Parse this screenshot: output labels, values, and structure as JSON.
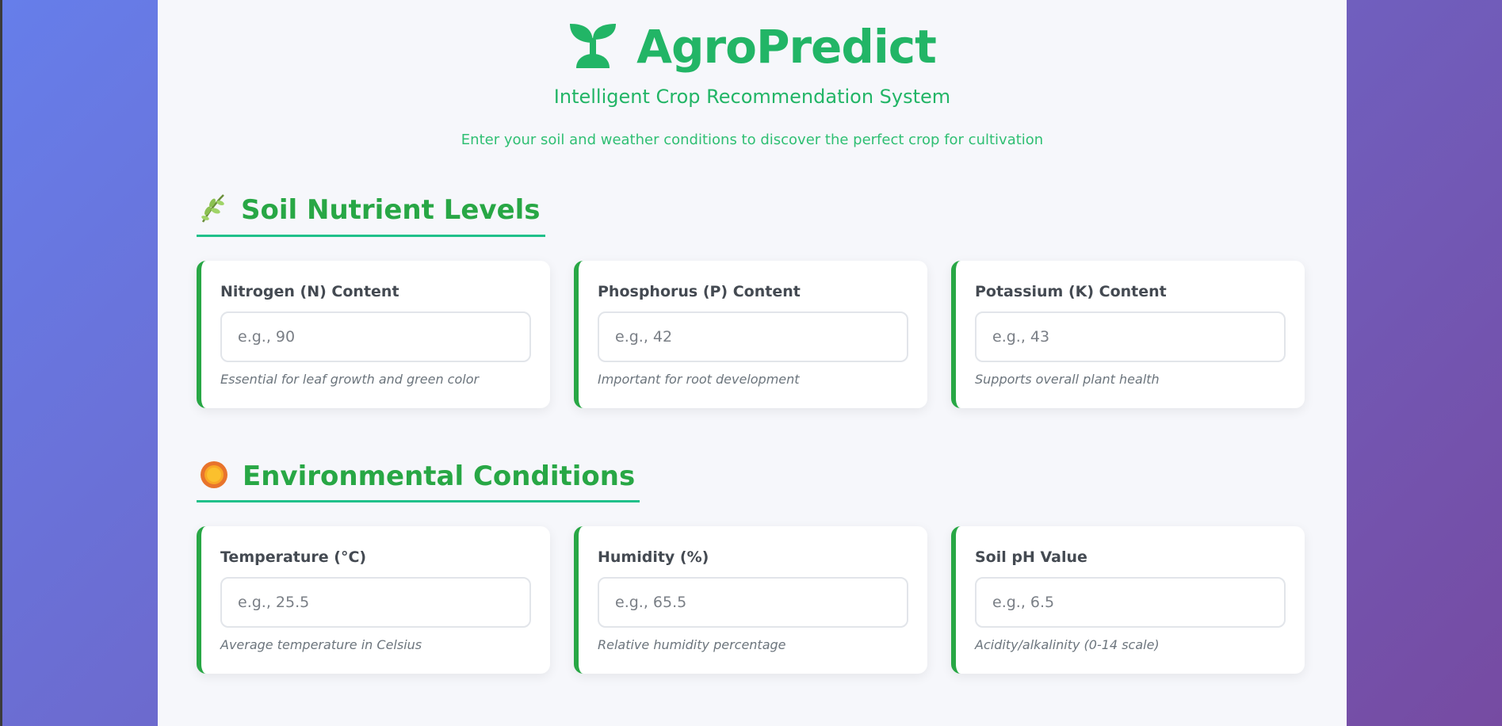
{
  "app": {
    "title": "AgroPredict",
    "subtitle": "Intelligent Crop Recommendation System",
    "tagline": "Enter your soil and weather conditions to discover the perfect crop for cultivation"
  },
  "sections": [
    {
      "icon": "herb-icon",
      "title": "Soil Nutrient Levels",
      "fields": [
        {
          "label": "Nitrogen (N) Content",
          "placeholder": "e.g., 90",
          "help": "Essential for leaf growth and green color"
        },
        {
          "label": "Phosphorus (P) Content",
          "placeholder": "e.g., 42",
          "help": "Important for root development"
        },
        {
          "label": "Potassium (K) Content",
          "placeholder": "e.g., 43",
          "help": "Supports overall plant health"
        }
      ]
    },
    {
      "icon": "sun-icon",
      "title": "Environmental Conditions",
      "fields": [
        {
          "label": "Temperature (°C)",
          "placeholder": "e.g., 25.5",
          "help": "Average temperature in Celsius"
        },
        {
          "label": "Humidity (%)",
          "placeholder": "e.g., 65.5",
          "help": "Relative humidity percentage"
        },
        {
          "label": "Soil pH Value",
          "placeholder": "e.g., 6.5",
          "help": "Acidity/alkalinity (0-14 scale)"
        }
      ]
    }
  ],
  "colors": {
    "brand": "#22b566",
    "accent": "#28a745",
    "underline": "#20c08a",
    "background_start": "#667eea",
    "background_end": "#764ba2"
  }
}
